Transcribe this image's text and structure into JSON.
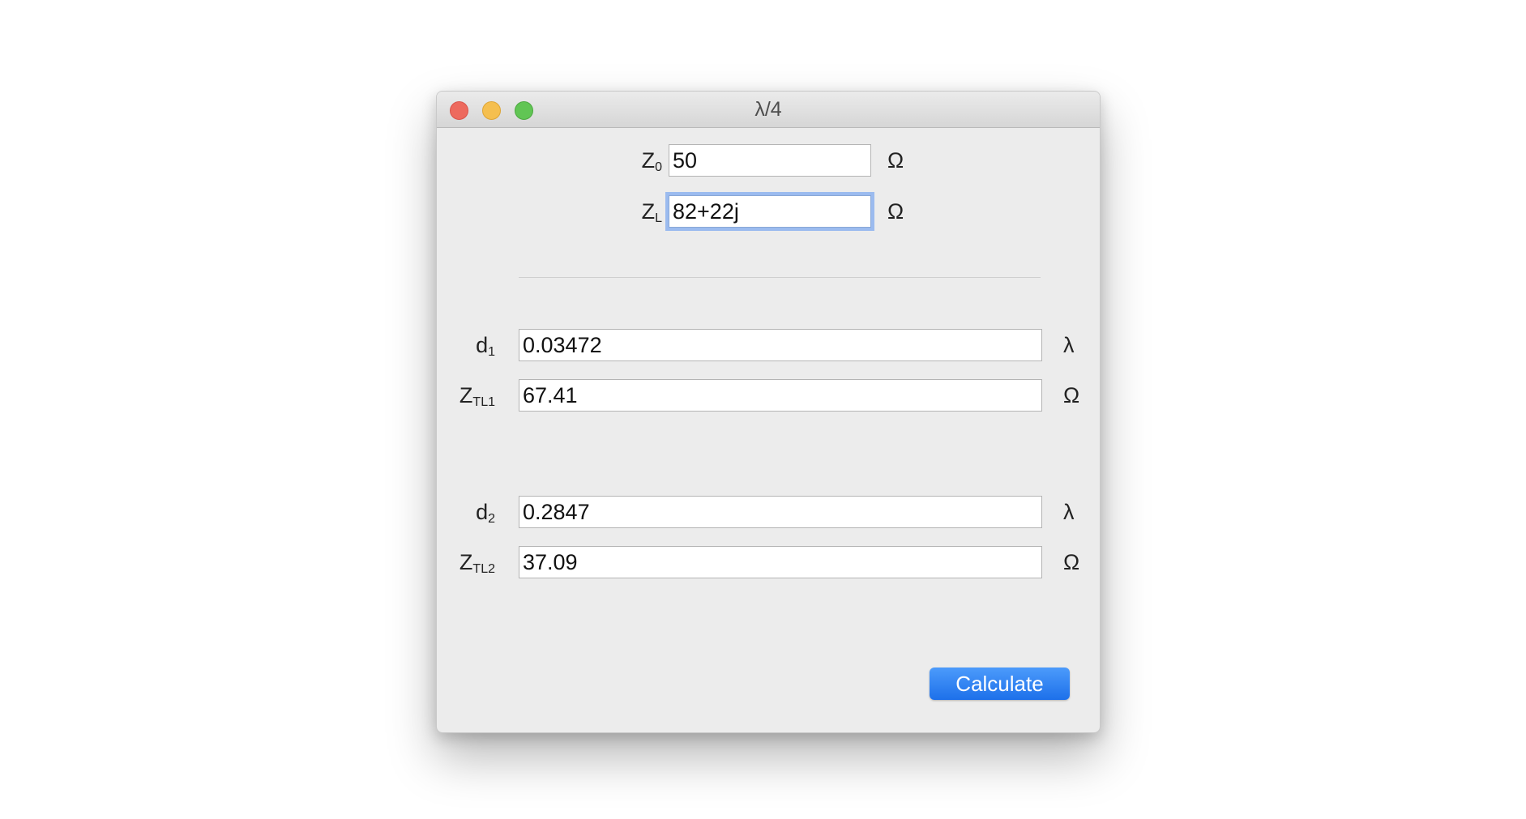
{
  "window": {
    "title": "λ/4"
  },
  "inputs": {
    "z0": {
      "label_main": "Z",
      "label_sub": "0",
      "value": "50",
      "unit": "Ω"
    },
    "zl": {
      "label_main": "Z",
      "label_sub": "L",
      "value": "82+22j",
      "unit": "Ω"
    }
  },
  "solution1": {
    "d": {
      "label_main": "d",
      "label_sub": "1",
      "value": "0.03472",
      "unit": "λ"
    },
    "ztl": {
      "label_main": "Z",
      "label_sub": "TL1",
      "value": "67.41",
      "unit": "Ω"
    }
  },
  "solution2": {
    "d": {
      "label_main": "d",
      "label_sub": "2",
      "value": "0.2847",
      "unit": "λ"
    },
    "ztl": {
      "label_main": "Z",
      "label_sub": "TL2",
      "value": "37.09",
      "unit": "Ω"
    }
  },
  "actions": {
    "calculate_label": "Calculate"
  },
  "colors": {
    "accent": "#1d70ea",
    "focus_ring": "#9bbbef",
    "close": "#ed6a5e",
    "minimize": "#f5bf4f",
    "maximize": "#61c554"
  }
}
